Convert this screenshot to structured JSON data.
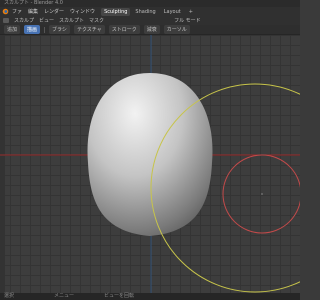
{
  "window": {
    "title": "スカルプト - Blender 4.0"
  },
  "menubar": {
    "menus": [
      "ファ",
      "編集",
      "レンダー",
      "ウィンドウ"
    ],
    "tabs": [
      "Sculpting",
      "Shading",
      "Layout",
      "+"
    ],
    "active_tab": "Sculpting"
  },
  "header": {
    "mode": "スカルプ",
    "view": "ビュー",
    "sculpt": "スカルプト",
    "mask": "マスク",
    "overlay": "フル  モード"
  },
  "toolbar": {
    "items": [
      "追加",
      "描画",
      "ブラシ",
      "テクスチャ",
      "ストローク",
      "減衰",
      "カーソル"
    ]
  },
  "status": {
    "left": "選択",
    "mid": "メニュー",
    "right": "ビューを回転"
  },
  "colors": {
    "accent": "#4772b3",
    "axis_x": "#9a2c2c",
    "axis_y": "#5f7a23",
    "brush_outer": "#c7c44a",
    "brush_inner": "#c24a4a"
  }
}
